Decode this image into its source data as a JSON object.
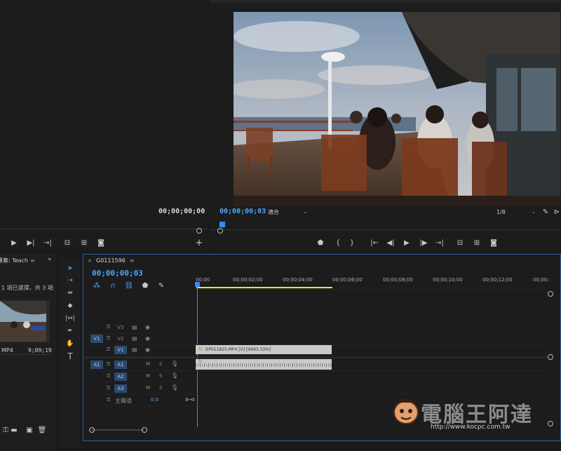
{
  "source_monitor": {
    "timecode": "00;00;00;00"
  },
  "program_monitor": {
    "timecode": "00;00;00;03",
    "fit_label": "適合",
    "resolution_label": "1/8",
    "video_scene": "ship-deck-dining-video-frame"
  },
  "project_panel": {
    "title": "專案: Teach",
    "selection_text": "1 項已選擇，共 3 項",
    "clip_name": "MP4",
    "clip_duration": "9;09;19"
  },
  "timeline": {
    "sequence_name": "G0111596",
    "timecode": "00;00;00;03",
    "ruler_ticks": [
      "00;00",
      "00;00;02;00",
      "00;00;04;00",
      "00;00;06;00",
      "00;00;08;00",
      "00;00;10;00",
      "00;00;12;00",
      "00;00;"
    ],
    "video_tracks": [
      {
        "source": "",
        "label": "V3"
      },
      {
        "source": "V1",
        "label": "V2"
      },
      {
        "source": "",
        "label": "V1"
      }
    ],
    "audio_tracks": [
      {
        "source": "A1",
        "label": "A1",
        "m": "M",
        "s": "S"
      },
      {
        "source": "",
        "label": "A2",
        "m": "M",
        "s": "S"
      },
      {
        "source": "",
        "label": "A3",
        "m": "M",
        "s": "S"
      }
    ],
    "master_label": "主聲道",
    "master_value": "0.0",
    "video_clip_label": "GP011825.MP4 [V] [9993.33%]",
    "fx_badge": "fx"
  },
  "watermark": {
    "title": "電腦王阿達",
    "url": "http://www.kocpc.com.tw"
  },
  "colors": {
    "accent_blue": "#2f8cff",
    "work_area_yellow": "#e6e14a",
    "track_target_bg": "#2d4a6e"
  }
}
